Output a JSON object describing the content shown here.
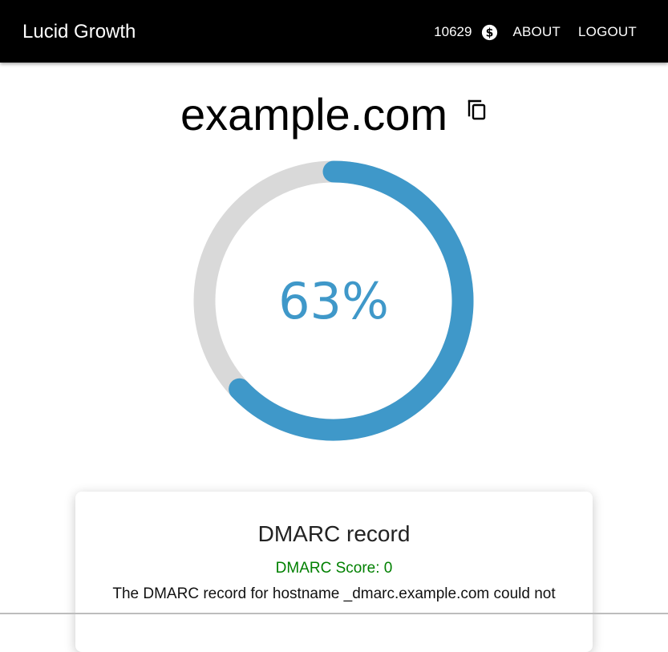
{
  "header": {
    "brand": "Lucid Growth",
    "credits": "10629",
    "about_label": "ABOUT",
    "logout_label": "LOGOUT"
  },
  "domain": {
    "name": "example.com"
  },
  "score": {
    "label": "63%",
    "fraction": 0.63,
    "colors": {
      "progress": "#3f98c9",
      "track": "#d9d9d9"
    }
  },
  "card": {
    "title": "DMARC record",
    "score_text": "DMARC Score: 0",
    "description": "The DMARC record for hostname _dmarc.example.com could not",
    "score_color": "#008000"
  }
}
